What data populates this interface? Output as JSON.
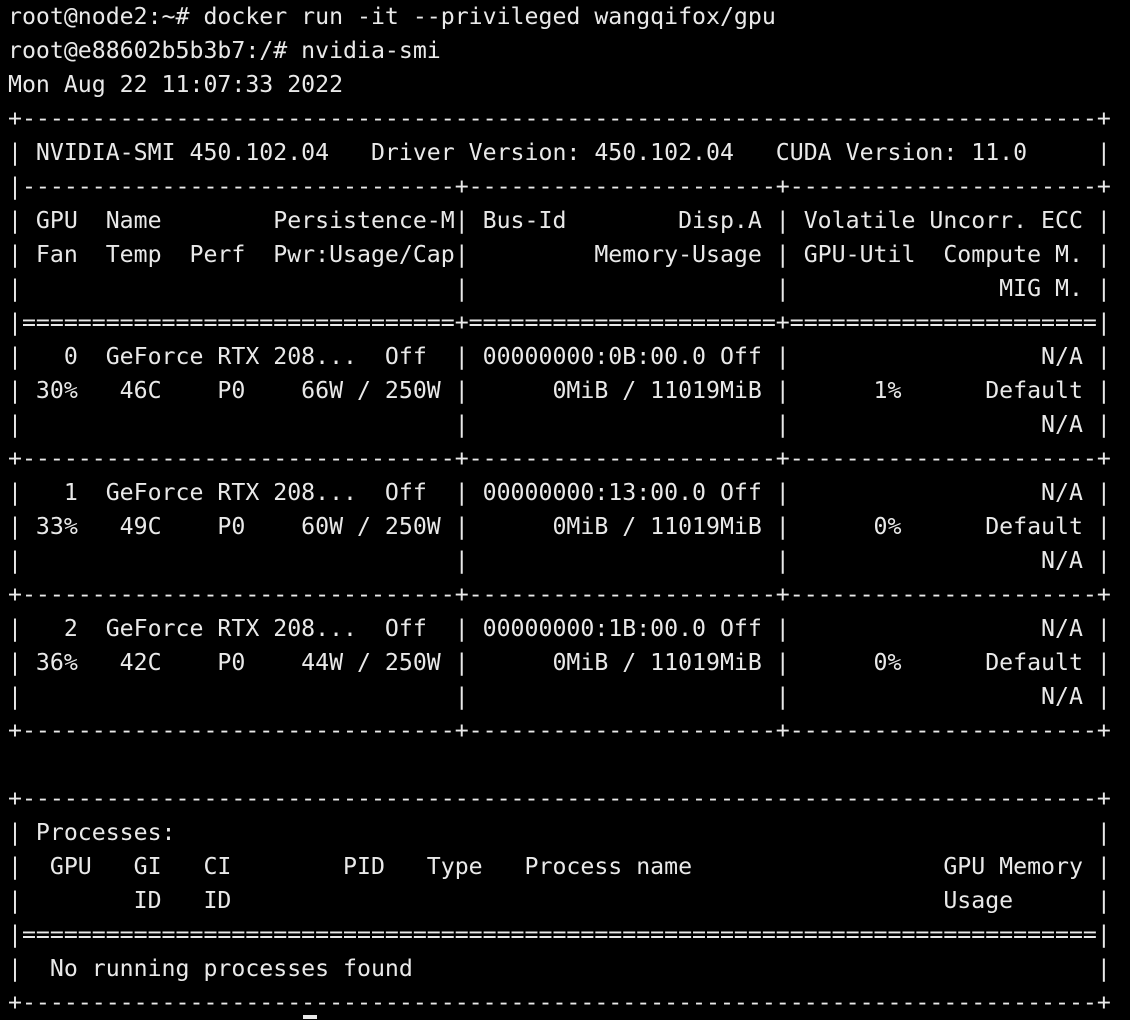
{
  "terminal": {
    "lines": [
      "root@node2:~# docker run -it --privileged wangqifox/gpu",
      "root@e88602b5b3b7:/# nvidia-smi",
      "Mon Aug 22 11:07:33 2022",
      "+-----------------------------------------------------------------------------+",
      "| NVIDIA-SMI 450.102.04   Driver Version: 450.102.04   CUDA Version: 11.0     |",
      "|-------------------------------+----------------------+----------------------+",
      "| GPU  Name        Persistence-M| Bus-Id        Disp.A | Volatile Uncorr. ECC |",
      "| Fan  Temp  Perf  Pwr:Usage/Cap|         Memory-Usage | GPU-Util  Compute M. |",
      "|                               |                      |               MIG M. |",
      "|===============================+======================+======================|",
      "|   0  GeForce RTX 208...  Off  | 00000000:0B:00.0 Off |                  N/A |",
      "| 30%   46C    P0    66W / 250W |      0MiB / 11019MiB |      1%      Default |",
      "|                               |                      |                  N/A |",
      "+-------------------------------+----------------------+----------------------+",
      "|   1  GeForce RTX 208...  Off  | 00000000:13:00.0 Off |                  N/A |",
      "| 33%   49C    P0    60W / 250W |      0MiB / 11019MiB |      0%      Default |",
      "|                               |                      |                  N/A |",
      "+-------------------------------+----------------------+----------------------+",
      "|   2  GeForce RTX 208...  Off  | 00000000:1B:00.0 Off |                  N/A |",
      "| 36%   42C    P0    44W / 250W |      0MiB / 11019MiB |      0%      Default |",
      "|                               |                      |                  N/A |",
      "+-------------------------------+----------------------+----------------------+",
      "",
      "+-----------------------------------------------------------------------------+",
      "| Processes:                                                                  |",
      "|  GPU   GI   CI        PID   Type   Process name                  GPU Memory |",
      "|        ID   ID                                                   Usage      |",
      "|=============================================================================|",
      "|  No running processes found                                                 |",
      "+-----------------------------------------------------------------------------+"
    ]
  },
  "colors": {
    "background": "#000000",
    "foreground": "#e9e9e9"
  }
}
